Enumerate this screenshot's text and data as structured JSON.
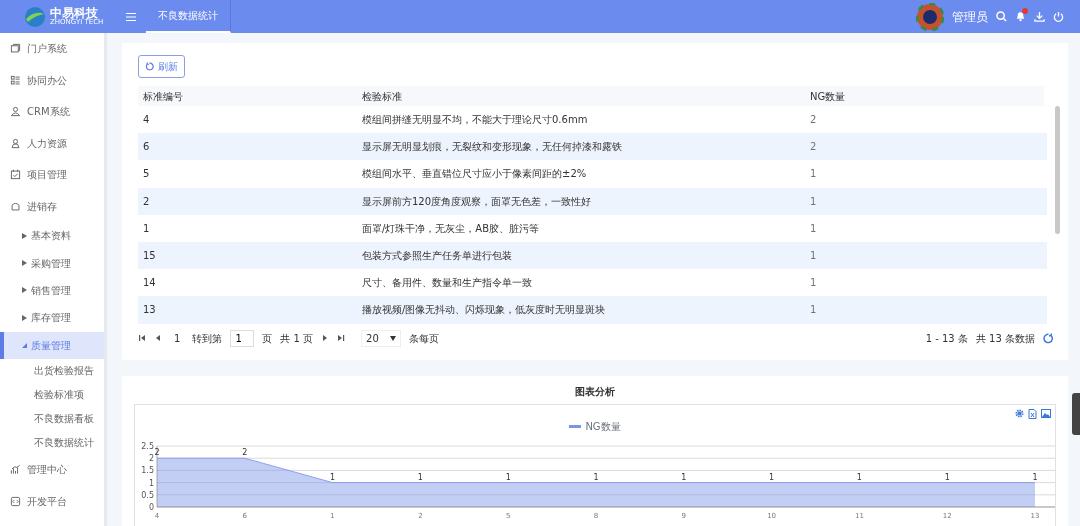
{
  "header": {
    "brand": "中易科技",
    "brand_sub": "ZHONGYI TECH",
    "tabs": [
      {
        "label": "不良数据统计",
        "selected": true
      }
    ],
    "user": "管理员",
    "notification": true
  },
  "sidebar": {
    "items": [
      {
        "label": "门户系统"
      },
      {
        "label": "协同办公"
      },
      {
        "label": "CRM系统"
      },
      {
        "label": "人力资源"
      },
      {
        "label": "项目管理"
      },
      {
        "label": "进销存",
        "expanded": true,
        "children": [
          {
            "label": "基本资料",
            "expanded": false,
            "selected": false
          },
          {
            "label": "采购管理",
            "expanded": false,
            "selected": false
          },
          {
            "label": "销售管理",
            "expanded": false,
            "selected": false
          },
          {
            "label": "库存管理",
            "expanded": false,
            "selected": false
          },
          {
            "label": "质量管理",
            "expanded": true,
            "selected": true,
            "children": [
              {
                "label": "出货检验报告"
              },
              {
                "label": "检验标准项"
              },
              {
                "label": "不良数据看板"
              },
              {
                "label": "不良数据统计"
              }
            ]
          }
        ]
      },
      {
        "label": "管理中心"
      },
      {
        "label": "开发平台"
      }
    ]
  },
  "toolbar": {
    "refresh": "刷新"
  },
  "table": {
    "columns": [
      "标准编号",
      "检验标准",
      "NG数量"
    ],
    "rows": [
      [
        "4",
        "模组间拼缝无明显不均，不能大于理论尺寸0.6mm",
        "2"
      ],
      [
        "6",
        "显示屏无明显划痕，无裂纹和变形现象，无任何掉漆和露铁",
        "2"
      ],
      [
        "5",
        "模组间水平、垂直错位尺寸应小于像素间距的±2%",
        "1"
      ],
      [
        "2",
        "显示屏前方120度角度观察，面罩无色差，一致性好",
        "1"
      ],
      [
        "1",
        "面罩/灯珠干净，无灰尘，AB胶、脏污等",
        "1"
      ],
      [
        "15",
        "包装方式参照生产任务单进行包装",
        "1"
      ],
      [
        "14",
        "尺寸、备用件、数量和生产指令单一致",
        "1"
      ],
      [
        "13",
        "播放视频/图像无抖动、闪烁现象，低灰度时无明显斑块",
        "1"
      ]
    ]
  },
  "pagination": {
    "page": "1",
    "goto_label": "转到第",
    "goto_value": "1",
    "page_unit": "页",
    "total_pages": "共 1 页",
    "page_size": "20",
    "page_size_label": "条每页",
    "range": "1 - 13 条",
    "total": "共 13 条数据"
  },
  "chart_panel": {
    "chart_data": {
      "type": "area",
      "title": "图表分析",
      "categories": [
        "4",
        "6",
        "1",
        "2",
        "5",
        "8",
        "9",
        "10",
        "11",
        "12",
        "13"
      ],
      "series": [
        {
          "name": "NG数量",
          "color": "#7b93e8",
          "values": [
            2,
            2,
            1,
            1,
            1,
            1,
            1,
            1,
            1,
            1,
            1
          ]
        }
      ],
      "grid": true,
      "ylim": [
        0,
        2.5
      ],
      "yticks": [
        0,
        0.5,
        1,
        1.5,
        2,
        2.5
      ],
      "data_labels": true
    }
  }
}
